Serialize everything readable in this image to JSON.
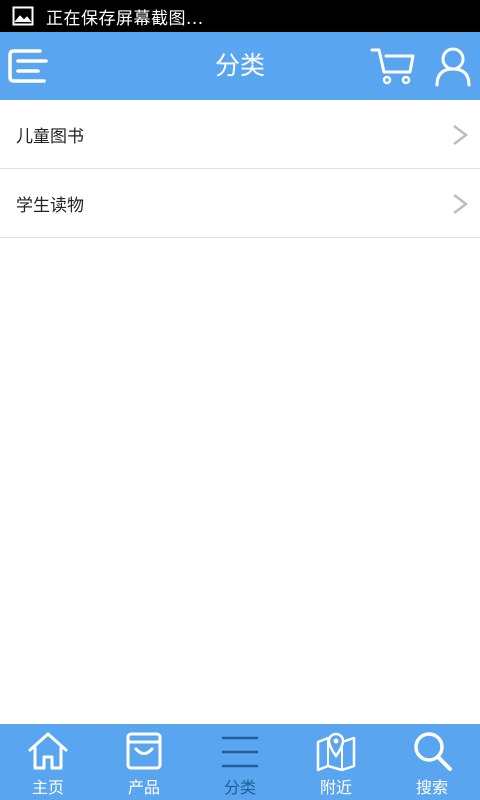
{
  "status_bar": {
    "text": "正在保存屏幕截图..."
  },
  "header": {
    "title": "分类",
    "icons": [
      "menu-icon",
      "cart-icon",
      "user-icon"
    ]
  },
  "categories": [
    {
      "label": "儿童图书"
    },
    {
      "label": "学生读物"
    }
  ],
  "tabbar": {
    "items": [
      {
        "label": "主页",
        "icon": "home-icon"
      },
      {
        "label": "产品",
        "icon": "shopping-bag-icon"
      },
      {
        "label": "分类",
        "icon": "category-lines-icon",
        "active": true
      },
      {
        "label": "附近",
        "icon": "map-pin-icon"
      },
      {
        "label": "搜索",
        "icon": "search-icon"
      }
    ]
  },
  "colors": {
    "primary": "#5aa5f0",
    "active_tab": "#1f5f9e",
    "status_bar": "#000000",
    "chevron": "#bdbdbd"
  }
}
